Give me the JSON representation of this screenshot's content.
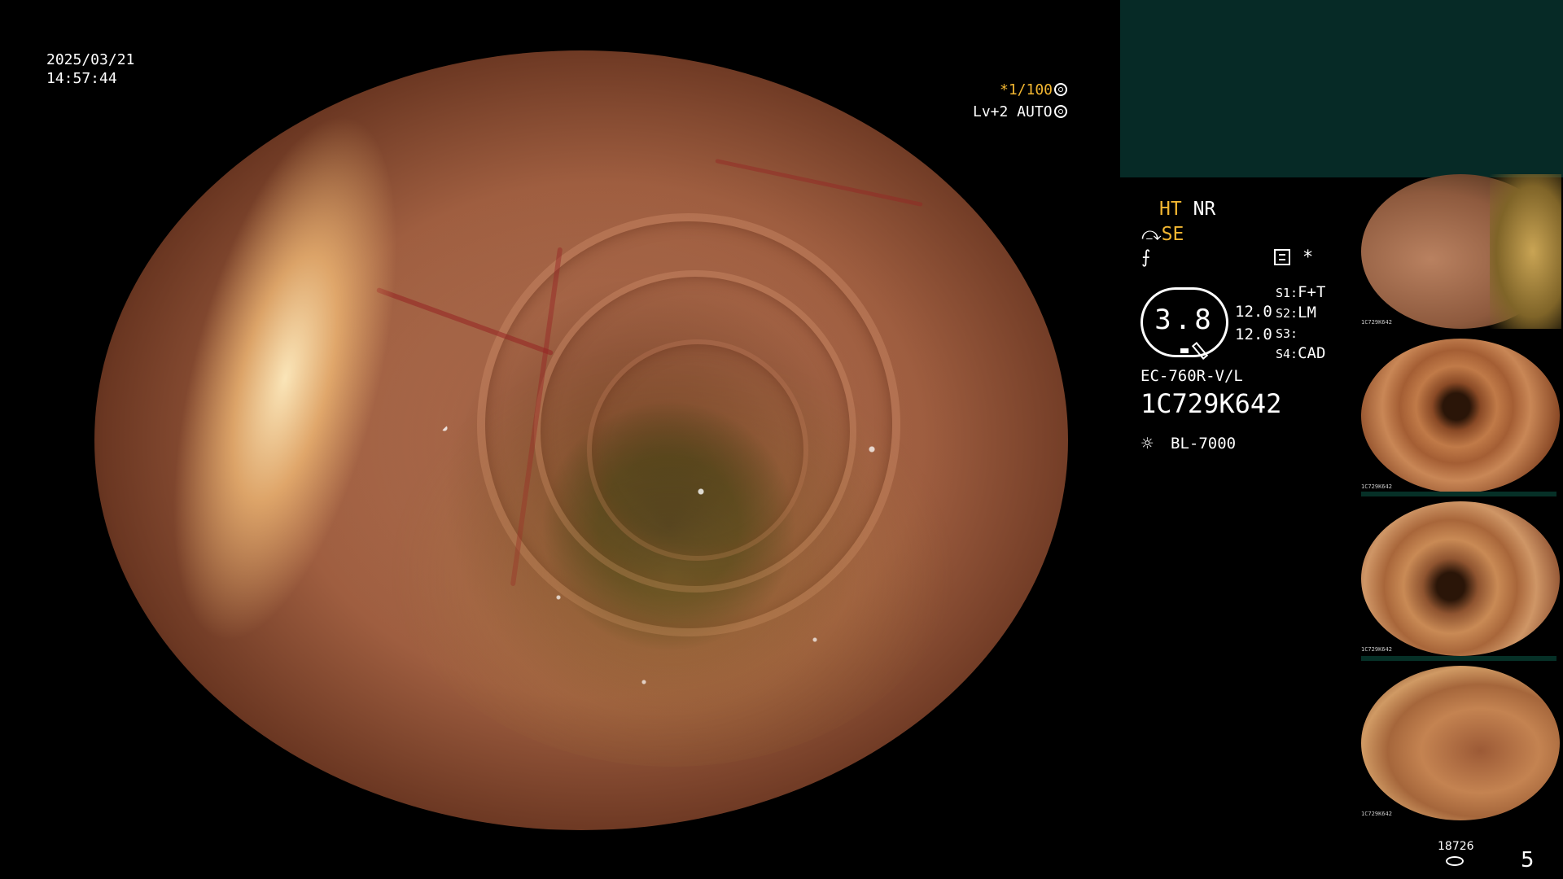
{
  "overlay": {
    "date": "2025/03/21",
    "time": "14:57:44",
    "shutter": "*1/100",
    "level": "Lv+2 AUTO"
  },
  "panel": {
    "mode_ht": "HT",
    "mode_nr": "NR",
    "mode_se": "SE",
    "star": "*",
    "gauge_value": "3.8",
    "gauge_n1": "12.0",
    "gauge_n2": "12.0",
    "slots": [
      {
        "key": "S1:",
        "value": "F+T"
      },
      {
        "key": "S2:",
        "value": "LM"
      },
      {
        "key": "S3:",
        "value": ""
      },
      {
        "key": "S4:",
        "value": "CAD"
      }
    ],
    "scope_model": "EC-760R-V/L",
    "scope_serial": "1C729K642",
    "light_source": "BL-7000"
  },
  "thumbnails": [
    {
      "caption": "1C729K642"
    },
    {
      "caption": "1C729K642"
    },
    {
      "caption": "1C729K642"
    },
    {
      "caption": "1C729K642"
    }
  ],
  "footer": {
    "frame_count": "18726",
    "page_number": "5"
  },
  "colors": {
    "accent_orange": "#f2b631",
    "panel_green": "#062a26",
    "background": "#000000"
  },
  "icons": [
    "aperture-icon",
    "auto-iris-icon",
    "scope-tool-icon",
    "list-icon",
    "light-icon",
    "disk-icon"
  ]
}
